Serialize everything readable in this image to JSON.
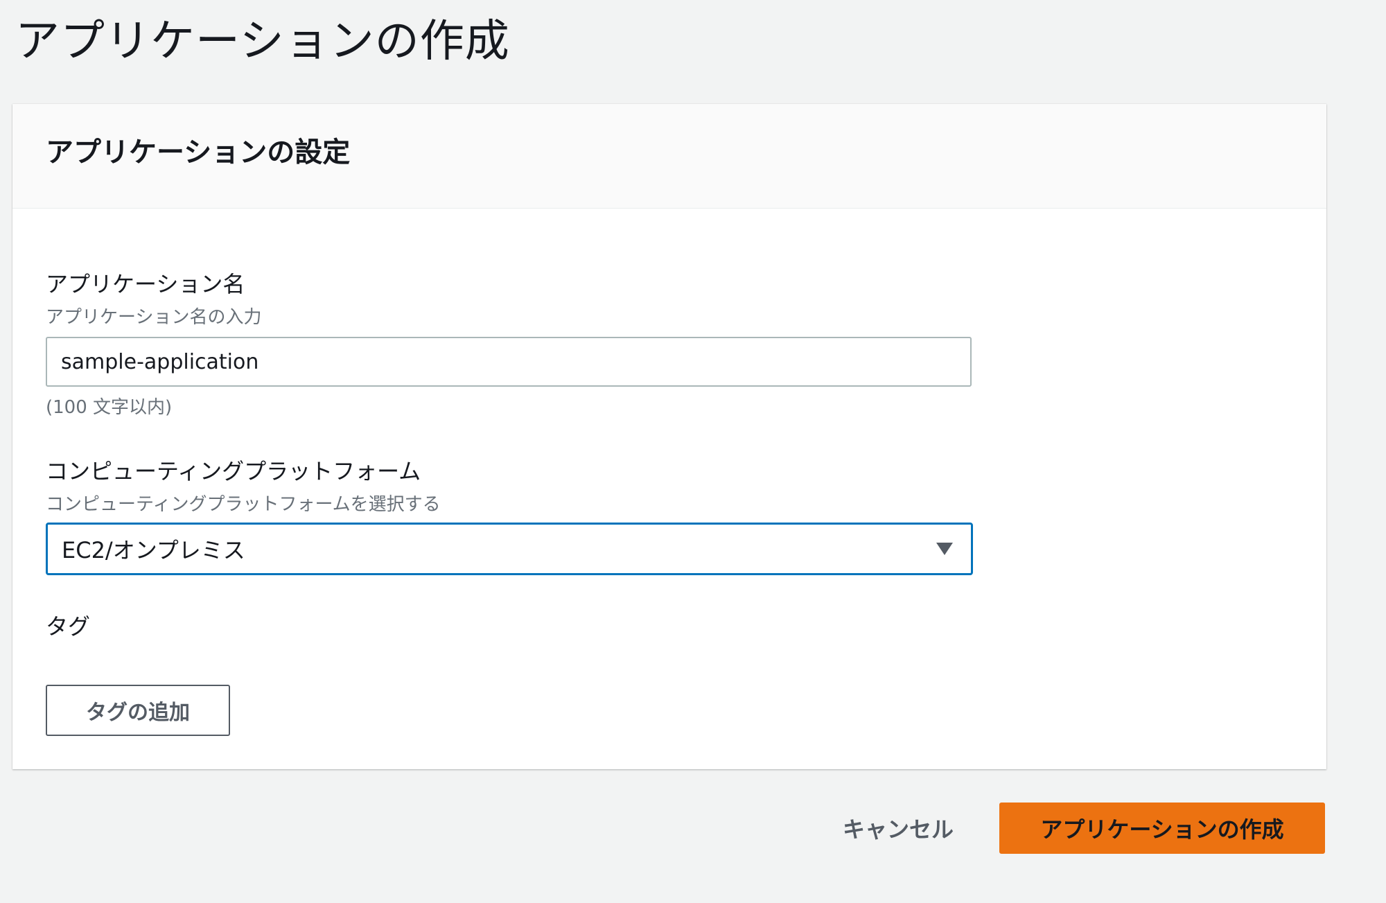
{
  "page": {
    "title": "アプリケーションの作成"
  },
  "panel": {
    "title": "アプリケーションの設定"
  },
  "fields": {
    "app_name": {
      "label": "アプリケーション名",
      "description": "アプリケーション名の入力",
      "value": "sample-application",
      "constraint": "(100 文字以内)"
    },
    "platform": {
      "label": "コンピューティングプラットフォーム",
      "description": "コンピューティングプラットフォームを選択する",
      "selected": "EC2/オンプレミス"
    },
    "tags": {
      "label": "タグ",
      "add_button": "タグの追加"
    }
  },
  "footer": {
    "cancel_label": "キャンセル",
    "create_label": "アプリケーションの作成"
  },
  "colors": {
    "background": "#f2f3f3",
    "primary": "#ec7211",
    "focus": "#0073bb",
    "secondary_text": "#687078"
  },
  "icons": {
    "select_caret": "caret-down-icon"
  }
}
